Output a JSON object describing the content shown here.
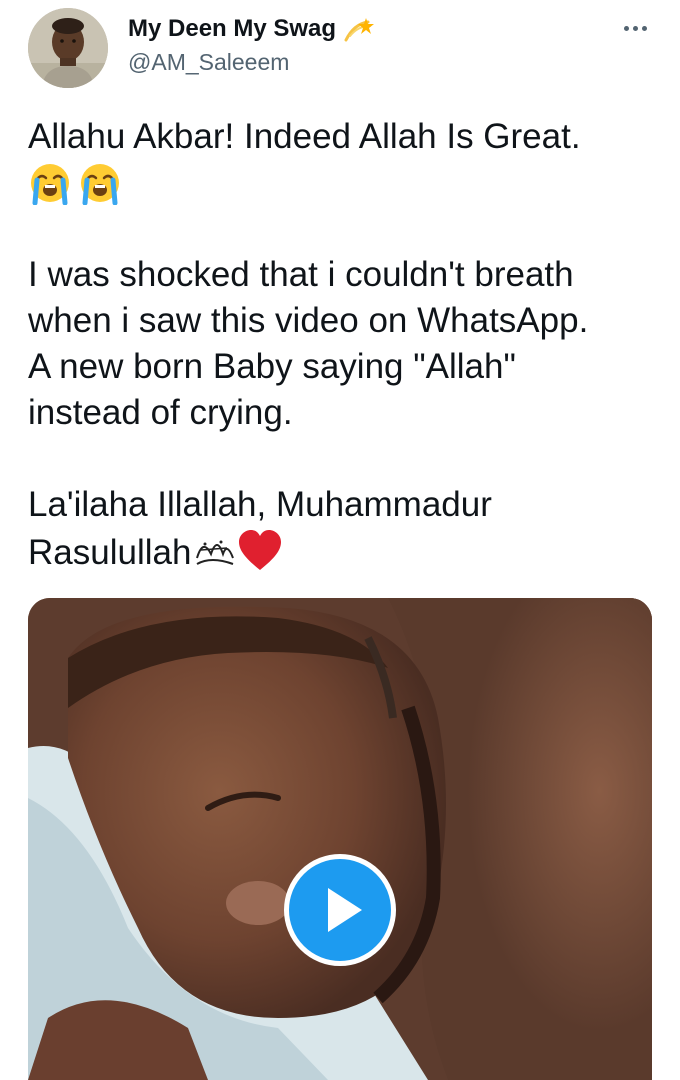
{
  "author": {
    "display_name": "My Deen My Swag",
    "handle": "@AM_Saleeem",
    "badge_icon": "shooting-star-emoji",
    "avatar_icon": "profile-photo-avatar"
  },
  "actions": {
    "more_icon": "more-horizontal-icon"
  },
  "tweet": {
    "line1": "Allahu Akbar! Indeed Allah Is Great.",
    "line1_emojis": [
      "loudly-crying-face-emoji",
      "loudly-crying-face-emoji"
    ],
    "para2_line1": "I was shocked that i couldn't breath",
    "para2_line2": "when i saw this video on WhatsApp.",
    "para2_line3": "A new born Baby saying \"Allah\"",
    "para2_line4": "instead of crying.",
    "para3_line1": "La'ilaha Illallah, Muhammadur",
    "para3_line2": "Rasulullah",
    "para3_symbols": [
      "sallallahu-alayhi-wasallam-ligature",
      "red-heart-emoji"
    ]
  },
  "media": {
    "type": "video",
    "play_icon": "play-icon",
    "accent_color": "#1d9bf0"
  }
}
